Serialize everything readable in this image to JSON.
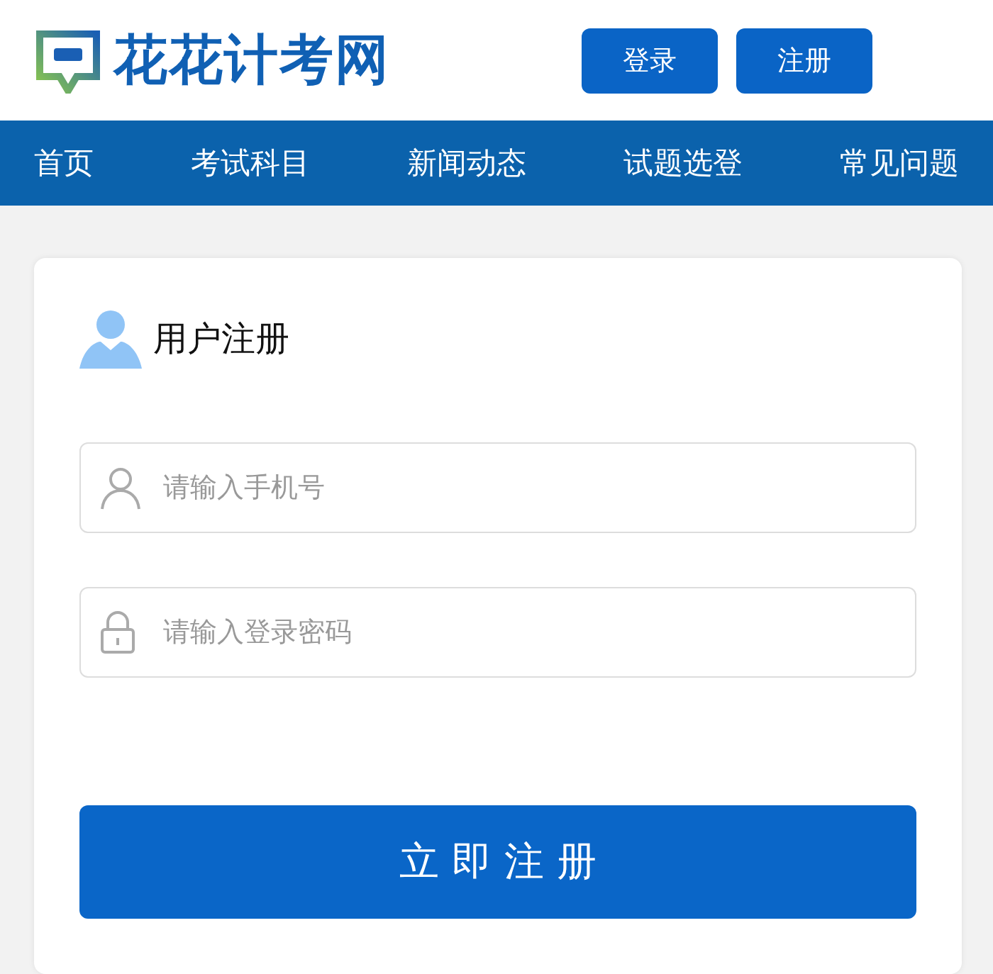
{
  "header": {
    "site_name": "花花计考网",
    "buttons": [
      "登录",
      "注册"
    ]
  },
  "nav": {
    "items": [
      "首页",
      "考试科目",
      "新闻动态",
      "试题选登",
      "常见问题"
    ]
  },
  "form": {
    "title": "用户注册",
    "fields": [
      {
        "kind": "phone",
        "placeholder": "请输入手机号"
      },
      {
        "kind": "password",
        "placeholder": "请输入登录密码"
      }
    ],
    "submit": "立 即 注 册"
  }
}
